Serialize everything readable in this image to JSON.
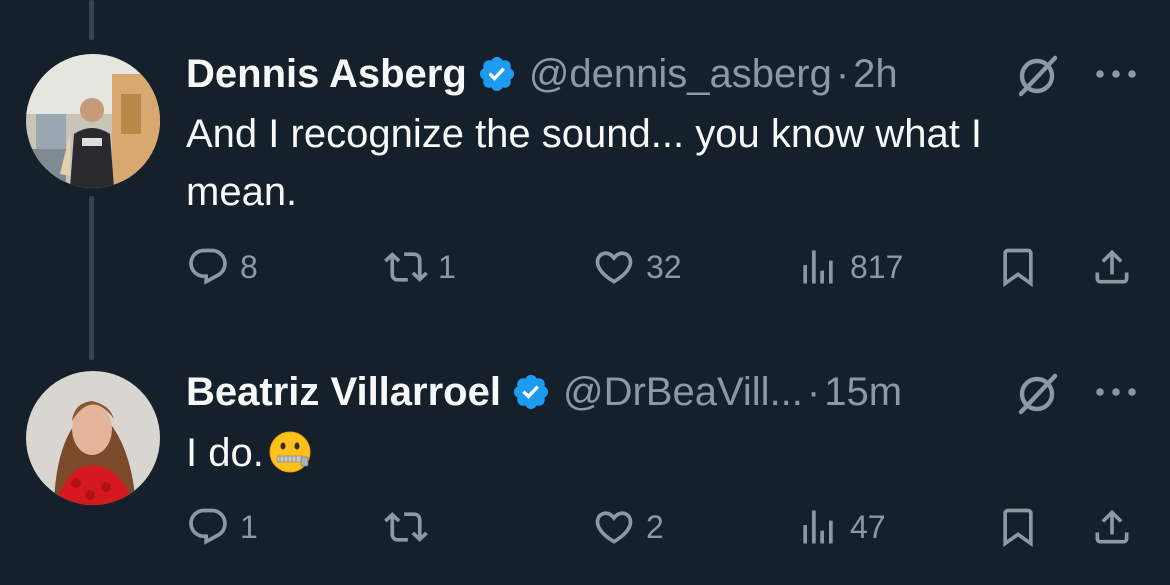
{
  "tweets": [
    {
      "name": "Dennis Asberg",
      "handle": "@dennis_asberg",
      "separator": "·",
      "time": "2h",
      "text_line1": "And I recognize the sound... you know what I",
      "text_line2": "mean.",
      "replies": "8",
      "reposts": "1",
      "likes": "32",
      "views": "817"
    },
    {
      "name": "Beatriz Villarroel",
      "handle": "@DrBeaVill...",
      "separator": "·",
      "time": "15m",
      "text": "I do.",
      "emoji": "zipper-mouth-face",
      "replies": "1",
      "reposts": "",
      "likes": "2",
      "views": "47"
    }
  ],
  "colors": {
    "background": "#15202b",
    "text": "#f7f9f9",
    "secondary": "#8b98a5",
    "verified": "#1d9bf0",
    "thread_line": "#38444d"
  }
}
